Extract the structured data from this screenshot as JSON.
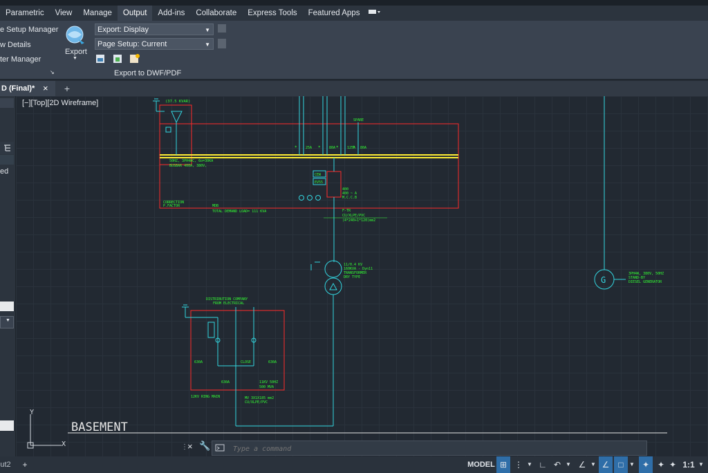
{
  "ribbon_tabs": [
    "Parametric",
    "View",
    "Manage",
    "Output",
    "Add-ins",
    "Collaborate",
    "Express Tools",
    "Featured Apps"
  ],
  "active_tab": "Output",
  "ribbon": {
    "left_items": [
      "e Setup Manager",
      "w Details",
      "ter Manager"
    ],
    "export_label": "Export",
    "export_dropdown": "Export: Display",
    "page_setup_dropdown": "Page Setup: Current",
    "panel_title": "Export to DWF/PDF"
  },
  "document_tab": {
    "title": "D (Final)*"
  },
  "viewport_label": "[−][Top][2D Wireframe]",
  "left_panel": {
    "partial_text": "ed"
  },
  "drawing": {
    "capacitor_label": "(37.5 KVAR)",
    "correction_label": [
      "CORRECTION",
      "P.FACTOR"
    ],
    "busbar_rating": [
      "50HZ, 3PH4WC, 6o=30KA",
      "BUSBAR 400A, 380V,"
    ],
    "mdb_label": "MDB",
    "total_demand": "TOTAL DEMAND LOAD= 111 KVA",
    "breaker_ratings": [
      "25A",
      "80A",
      "125A",
      "80A"
    ],
    "spare": "SPARE",
    "main_breaker": [
      "400",
      "400 ~ A",
      "M.C.C.B"
    ],
    "meters": [
      "CEW",
      "EV55"
    ],
    "cable_labels": [
      "F-TR",
      "CU/XLPE/PVC",
      "(4*240+1*120)mm2"
    ],
    "transformer": [
      "11/0.4 KV",
      "160KVA - Dyn11",
      "TRANSFORMER",
      "DRY TYPE"
    ],
    "generator": [
      "3PH4W, 380V, 50HZ",
      "STAND-BY",
      "DIESEL GENERATOR"
    ],
    "generator_symbol": "G",
    "distribution": [
      "DISTRIBUTION COMPANY",
      "FROM ELECTRICAL"
    ],
    "rmu_ratings": [
      "630A",
      "630A",
      "630A",
      "CLOSE"
    ],
    "rmu_bottom": [
      "630A",
      "11KV 50HZ",
      "500 MVA"
    ],
    "ring_main": "12KV RING MAIN",
    "mv_cable": [
      "MV 3X1X185 mm2",
      "CU/XLPE/PVC"
    ],
    "basement": "BASEMENT",
    "ucs_x": "X",
    "ucs_y": "Y"
  },
  "command_placeholder": "Type a command",
  "status": {
    "layout_tab": "ut2",
    "model": "MODEL",
    "scale": "1:1"
  },
  "colors": {
    "red": "#ff2a2a",
    "cyan": "#33d6e0",
    "green": "#33ff33",
    "yellow": "#ffee33",
    "white": "#e6e6e6"
  }
}
